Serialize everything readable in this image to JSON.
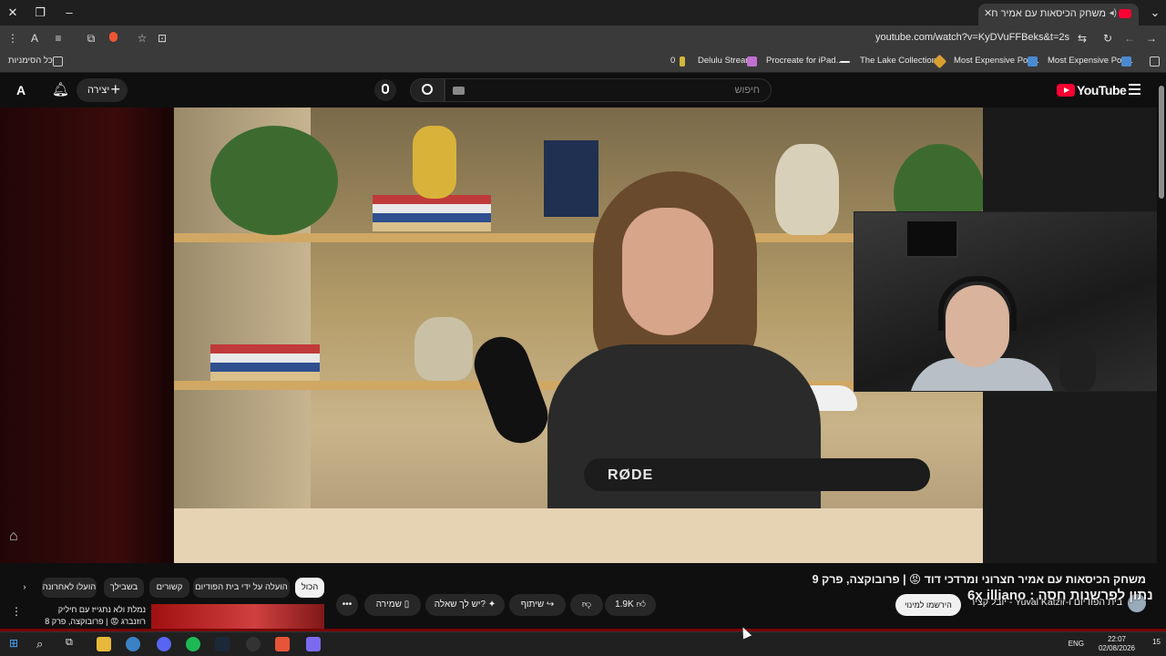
{
  "browser": {
    "tab_title": "משחק הכיסאות עם אמיר ח",
    "url": "youtube.com/watch?v=KyDVuFFBeks&t=2s",
    "bookmarks": [
      {
        "label": "Delulu Stream"
      },
      {
        "label": "Procreate for iPad..."
      },
      {
        "label": "The Lake Collection..."
      },
      {
        "label": "Most Expensive Pok..."
      },
      {
        "label": "Most Expensive Pok..."
      }
    ],
    "bookmark_count": "0",
    "all_bookmarks": "כל הסימניות"
  },
  "youtube": {
    "logo_text": "YouTube",
    "search_placeholder": "חיפוש",
    "create_label": "יצירה",
    "video_title": "משחק הכיסאות עם אמיר חצרוני ומרדכי דוד 😡 | פרובוקצה, פרק 9",
    "channel_line": "בית הפודיום ו-Yuval Katzir - יובל קציר",
    "subscribe_label": "הירשמו למינוי",
    "overlay_text": "נתון לפרשנות חסה : 6x illiano",
    "mic_brand": "RØDE",
    "actions": {
      "like_count": "1.9K",
      "share": "שיתוף",
      "ask": "יש לך שאלה?",
      "save": "שמירה"
    },
    "chips": [
      {
        "label": "הכול",
        "active": true
      },
      {
        "label": "הועלה על ידי בית הפודיום",
        "active": false
      },
      {
        "label": "קשורים",
        "active": false
      },
      {
        "label": "בשבילך",
        "active": false
      },
      {
        "label": "הועלו לאחרונה",
        "active": false
      }
    ],
    "recommendation_title": "נמלת ולא נתגייז עם חיליק רוזנברג 😡 | פרובוקצה, פרק 8"
  },
  "taskbar": {
    "lang": "ENG",
    "time": "22:07",
    "date": "02/08/2026",
    "notification_count": "15"
  },
  "colors": {
    "yt_red": "#ff0033",
    "bg": "#0f0f0f"
  }
}
